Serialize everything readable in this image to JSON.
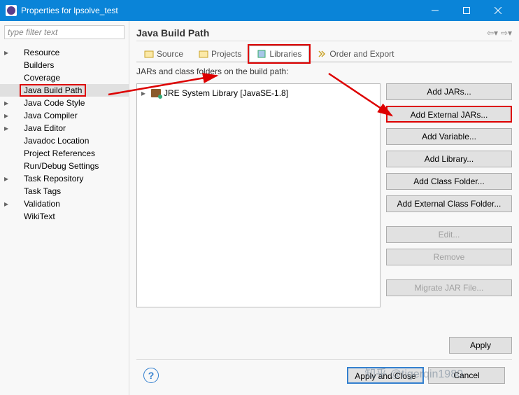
{
  "window": {
    "title": "Properties for lpsolve_test"
  },
  "sidebar": {
    "filter_placeholder": "type filter text",
    "items": [
      {
        "label": "Resource",
        "expandable": true
      },
      {
        "label": "Builders",
        "expandable": false
      },
      {
        "label": "Coverage",
        "expandable": false
      },
      {
        "label": "Java Build Path",
        "expandable": false,
        "selected": true,
        "highlighted": true
      },
      {
        "label": "Java Code Style",
        "expandable": true
      },
      {
        "label": "Java Compiler",
        "expandable": true
      },
      {
        "label": "Java Editor",
        "expandable": true
      },
      {
        "label": "Javadoc Location",
        "expandable": false
      },
      {
        "label": "Project References",
        "expandable": false
      },
      {
        "label": "Run/Debug Settings",
        "expandable": false
      },
      {
        "label": "Task Repository",
        "expandable": true
      },
      {
        "label": "Task Tags",
        "expandable": false
      },
      {
        "label": "Validation",
        "expandable": true
      },
      {
        "label": "WikiText",
        "expandable": false
      }
    ]
  },
  "main": {
    "heading": "Java Build Path",
    "tabs": [
      {
        "label": "Source",
        "active": false
      },
      {
        "label": "Projects",
        "active": false
      },
      {
        "label": "Libraries",
        "active": true,
        "highlighted": true
      },
      {
        "label": "Order and Export",
        "active": false
      }
    ],
    "jars_label": "JARs and class folders on the build path:",
    "tree_item": "JRE System Library [JavaSE-1.8]",
    "buttons": {
      "add_jars": "Add JARs...",
      "add_external_jars": "Add External JARs...",
      "add_variable": "Add Variable...",
      "add_library": "Add Library...",
      "add_class_folder": "Add Class Folder...",
      "add_ext_class_folder": "Add External Class Folder...",
      "edit": "Edit...",
      "remove": "Remove",
      "migrate": "Migrate JAR File..."
    },
    "apply": "Apply"
  },
  "footer": {
    "apply_close": "Apply and Close",
    "cancel": "Cancel"
  },
  "watermark": "知乎 @tigerqin1980",
  "colors": {
    "titlebar": "#0a84d8",
    "highlight": "#d00"
  }
}
